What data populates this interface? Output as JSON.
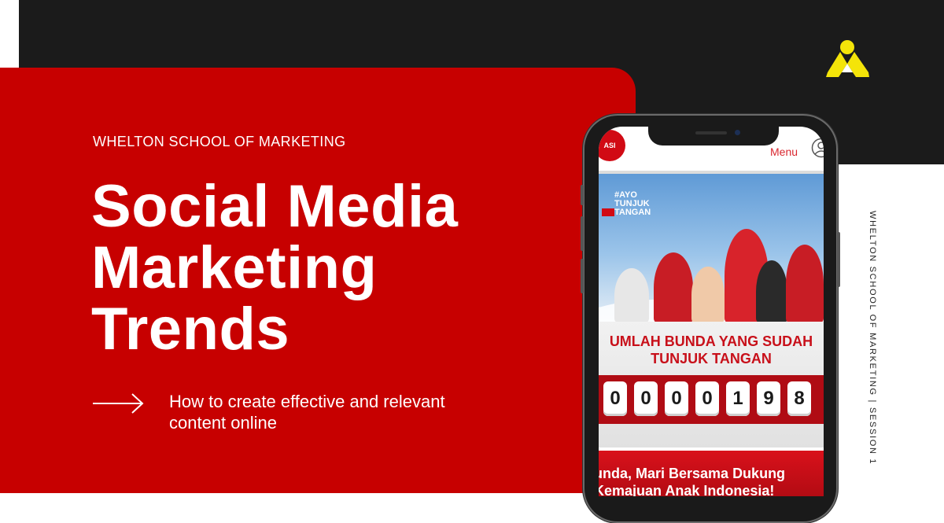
{
  "school_name": "WHELTON SCHOOL OF MARKETING",
  "title": {
    "line1": "Social Media",
    "line2": "Marketing",
    "line3": "Trends"
  },
  "subtitle": "How to create effective and relevant content online",
  "vertical_label": "WHELTON SCHOOL OF MARKETING | SESSION 1",
  "phone": {
    "logo_text": "ASI",
    "menu_label": "Menu",
    "banner_tag": "#AYO TUNJUK TANGAN",
    "counter_heading_line1": "UMLAH BUNDA YANG SUDAH",
    "counter_heading_line2": "TUNJUK TANGAN",
    "counter_digits": [
      "0",
      "0",
      "0",
      "0",
      "1",
      "9",
      "8"
    ],
    "bottom_line1": "unda, Mari Bersama Dukung",
    "bottom_line2": "Kemajuan Anak Indonesia!"
  },
  "colors": {
    "accent_red": "#c70000",
    "dark": "#1b1b1b",
    "logo_yellow": "#f4e409"
  },
  "icons": {
    "arrow": "arrow-right-icon",
    "logo": "triangle-logo-icon",
    "user": "user-icon"
  }
}
